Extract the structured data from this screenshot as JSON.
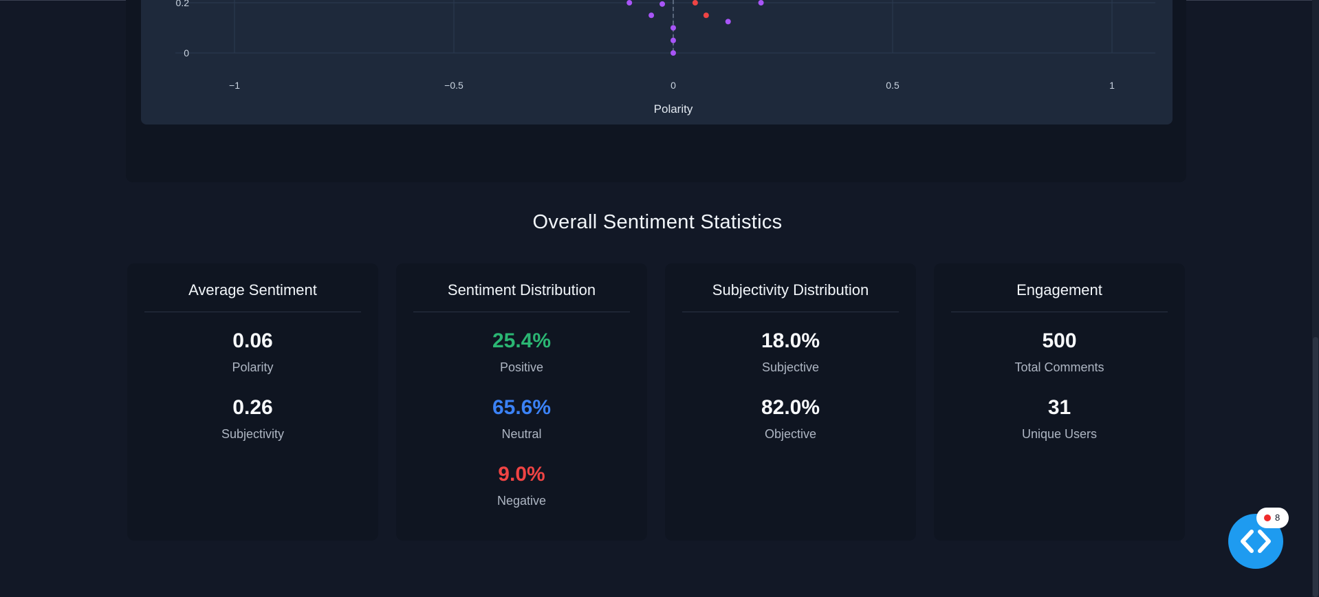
{
  "chart_data": {
    "type": "scatter",
    "xlabel": "Polarity",
    "ylabel": "",
    "xlim": [
      -1.1,
      1.1
    ],
    "x_ticks": [
      -1,
      -0.5,
      0,
      0.5,
      1
    ],
    "x_tick_labels": [
      "−1",
      "−0.5",
      "0",
      "0.5",
      "1"
    ],
    "y_ticks": [
      0,
      0.2
    ],
    "y_tick_labels": [
      "0",
      "0.2"
    ],
    "grid": true,
    "series": [
      {
        "color": "#a855f7",
        "points": [
          {
            "x": -0.1,
            "y": 0.2
          },
          {
            "x": -0.025,
            "y": 0.195
          },
          {
            "x": -0.05,
            "y": 0.15
          },
          {
            "x": 0.0,
            "y": 0.1
          },
          {
            "x": 0.0,
            "y": 0.05
          },
          {
            "x": 0.0,
            "y": 0.0
          },
          {
            "x": 0.125,
            "y": 0.125
          },
          {
            "x": 0.2,
            "y": 0.2
          }
        ]
      },
      {
        "color": "#ef4444",
        "points": [
          {
            "x": 0.05,
            "y": 0.2
          },
          {
            "x": 0.075,
            "y": 0.15
          }
        ]
      }
    ]
  },
  "stats": {
    "title": "Overall Sentiment Statistics",
    "cards": [
      {
        "title": "Average Sentiment",
        "items": [
          {
            "value": "0.06",
            "label": "Polarity"
          },
          {
            "value": "0.26",
            "label": "Subjectivity"
          }
        ]
      },
      {
        "title": "Sentiment Distribution",
        "items": [
          {
            "value": "25.4%",
            "label": "Positive"
          },
          {
            "value": "65.6%",
            "label": "Neutral"
          },
          {
            "value": "9.0%",
            "label": "Negative"
          }
        ]
      },
      {
        "title": "Subjectivity Distribution",
        "items": [
          {
            "value": "18.0%",
            "label": "Subjective"
          },
          {
            "value": "82.0%",
            "label": "Objective"
          }
        ]
      },
      {
        "title": "Engagement",
        "items": [
          {
            "value": "500",
            "label": "Total Comments"
          },
          {
            "value": "31",
            "label": "Unique Users"
          }
        ]
      }
    ]
  },
  "fab": {
    "icon": "code-icon",
    "badge_count": "8"
  },
  "colors": {
    "positive": "#2bb673",
    "neutral": "#3b82f6",
    "negative": "#ef4444",
    "fab": "#1e9bf0"
  }
}
